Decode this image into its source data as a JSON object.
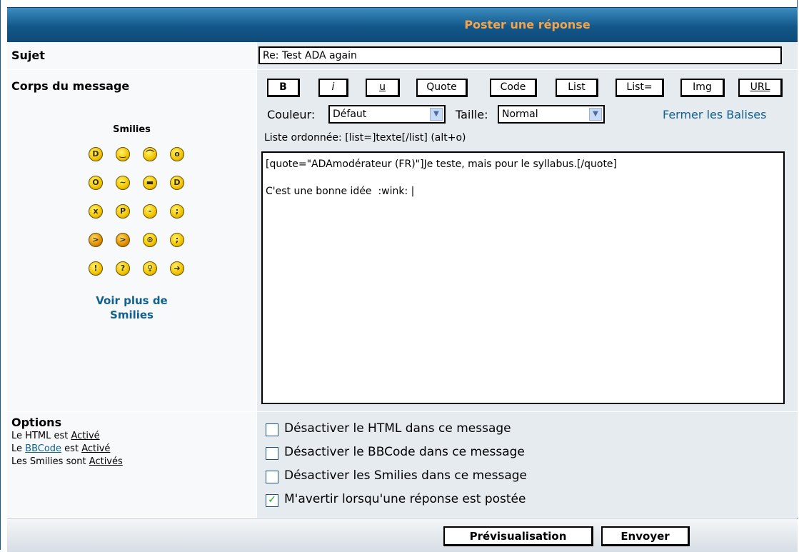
{
  "header": {
    "title": "Poster une réponse"
  },
  "subject": {
    "label": "Sujet",
    "value": "Re: Test ADA again"
  },
  "body": {
    "label": "Corps du message",
    "smilies_title": "Smilies",
    "smilies": [
      "very-happy",
      "smile",
      "sad",
      "surprised",
      "shocked",
      "confused",
      "cool",
      "laughing",
      "mad",
      "razz",
      "embarrassed",
      "crying",
      "evil",
      "twisted-evil",
      "rolling-eyes",
      "wink",
      "exclamation",
      "question",
      "idea",
      "arrow"
    ],
    "more_smilies_line1": "Voir plus de",
    "more_smilies_line2": "Smilies"
  },
  "toolbar": {
    "buttons": [
      "B",
      "i",
      "u",
      "Quote",
      "Code",
      "List",
      "List=",
      "Img",
      "URL"
    ],
    "color_label": "Couleur:",
    "color_value": "Défaut",
    "size_label": "Taille:",
    "size_value": "Normal",
    "close_tags": "Fermer les Balises",
    "help_text": "Liste ordonnée: [list=]texte[/list] (alt+o)"
  },
  "message": {
    "line1": "[quote=\"ADAmodérateur (FR)\"]Je teste, mais pour le syllabus.[/quote]",
    "line2": "C'est une bonne idée  :wink: |"
  },
  "options": {
    "title": "Options",
    "html_prefix": "Le HTML est ",
    "html_status": "Activé",
    "bbcode_prefix": "Le ",
    "bbcode_link": "BBCode",
    "bbcode_mid": " est ",
    "bbcode_status": "Activé",
    "smilies_prefix": "Les Smilies sont ",
    "smilies_status": "Activés",
    "checkboxes": [
      {
        "label": "Désactiver le HTML dans ce message",
        "checked": false
      },
      {
        "label": "Désactiver le BBCode dans ce message",
        "checked": false
      },
      {
        "label": "Désactiver les Smilies dans ce message",
        "checked": false
      },
      {
        "label": "M'avertir lorsqu'une réponse est postée",
        "checked": true
      }
    ]
  },
  "footer": {
    "preview": "Prévisualisation",
    "submit": "Envoyer"
  }
}
